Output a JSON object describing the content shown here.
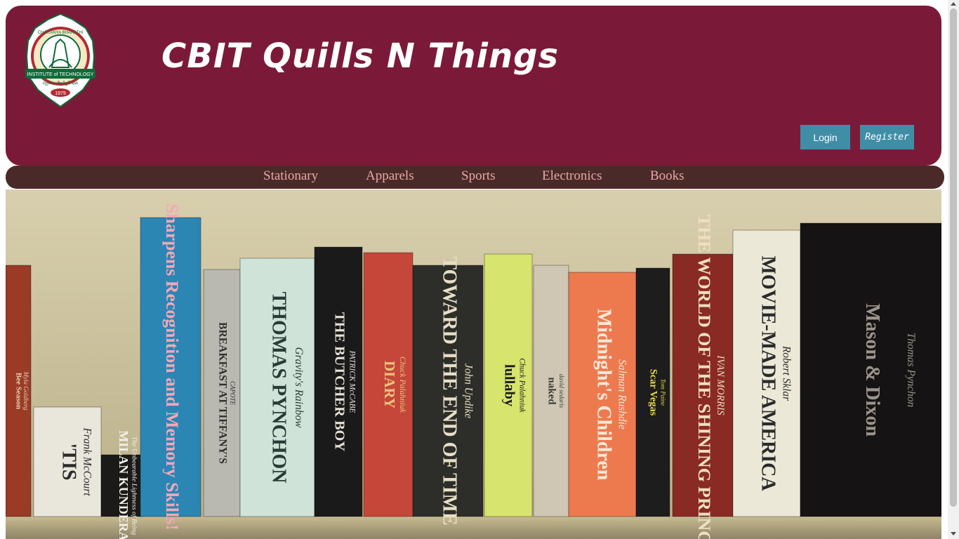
{
  "header": {
    "title": "CBIT Quills N Things",
    "logo": {
      "icon": "college-seal-logo",
      "top_text": "CHAITANYA BHARATHI",
      "ribbon_text": "INSTITUTE of TECHNOLOGY",
      "motto": "స్వయం తేజస్విన్ భవ",
      "year": "1979"
    },
    "login_label": "Login",
    "register_label": "Register"
  },
  "nav": {
    "items": [
      {
        "label": "Stationary"
      },
      {
        "label": "Apparels"
      },
      {
        "label": "Sports"
      },
      {
        "label": "Electronics"
      },
      {
        "label": "Books"
      }
    ]
  },
  "banner": {
    "image": "bookshelf-photo",
    "books": [
      {
        "title": "Bee Season",
        "author": "Myla Goldberg",
        "color": "#9a3b26",
        "text_color": "#e8d2b0"
      },
      {
        "title": "'TIS",
        "author": "Frank McCourt",
        "color": "#e9e6dc",
        "text_color": "#2b2b2b"
      },
      {
        "title": "MILAN KUNDERA",
        "author": "The Unbearable Lightness of Being",
        "color": "#1c1a18",
        "text_color": "#f3f0e6"
      },
      {
        "title": "Sharpens Recognition and Memory Skills!",
        "author": "",
        "color": "#2b86b4",
        "text_color": "#f2a8b8"
      },
      {
        "title": "BREAKFAST AT TIFFANY'S",
        "author": "CAPOTE",
        "color": "#b9b8b1",
        "text_color": "#2e2e2e"
      },
      {
        "title": "THOMAS PYNCHON",
        "author": "Gravity's Rainbow",
        "color": "#cfe3d9",
        "text_color": "#2a3b35"
      },
      {
        "title": "THE BUTCHER BOY",
        "author": "PATRICK McCABE",
        "color": "#1b1a1a",
        "text_color": "#e7e2d6"
      },
      {
        "title": "DIARY",
        "author": "Chuck Palahniuk",
        "color": "#c4473a",
        "text_color": "#e9c37a"
      },
      {
        "title": "TOWARD THE END OF TIME",
        "author": "John Updike",
        "color": "#2d2d29",
        "text_color": "#e7dfc5"
      },
      {
        "title": "lullaby",
        "author": "Chuck Palahniuk",
        "color": "#d7e46d",
        "text_color": "#1a1a1a"
      },
      {
        "title": "naked",
        "author": "david sedaris",
        "color": "#cfc7b4",
        "text_color": "#3b3a36"
      },
      {
        "title": "Midnight's Children",
        "author": "Salman Rushdie",
        "color": "#ec7a4e",
        "text_color": "#fbe7d8"
      },
      {
        "title": "Scar Vegas",
        "author": "Tom Paine",
        "color": "#1d1d1d",
        "text_color": "#e6d84c"
      },
      {
        "title": "THE WORLD OF THE SHINING PRINCE",
        "author": "IVAN MORRIS",
        "color": "#8a2a24",
        "text_color": "#f0dfc2"
      },
      {
        "title": "MOVIE-MADE AMERICA",
        "author": "Robert Sklar",
        "color": "#ebe8d8",
        "text_color": "#2a2a2a"
      },
      {
        "title": "Mason & Dixon",
        "author": "Thomas Pynchon",
        "color": "#151313",
        "text_color": "#9c948a"
      }
    ]
  },
  "colors": {
    "header_bg": "#7b1a38",
    "nav_bg": "#4a2a29",
    "nav_text": "#e7a7a7",
    "button_bg": "#3f8ea6"
  }
}
